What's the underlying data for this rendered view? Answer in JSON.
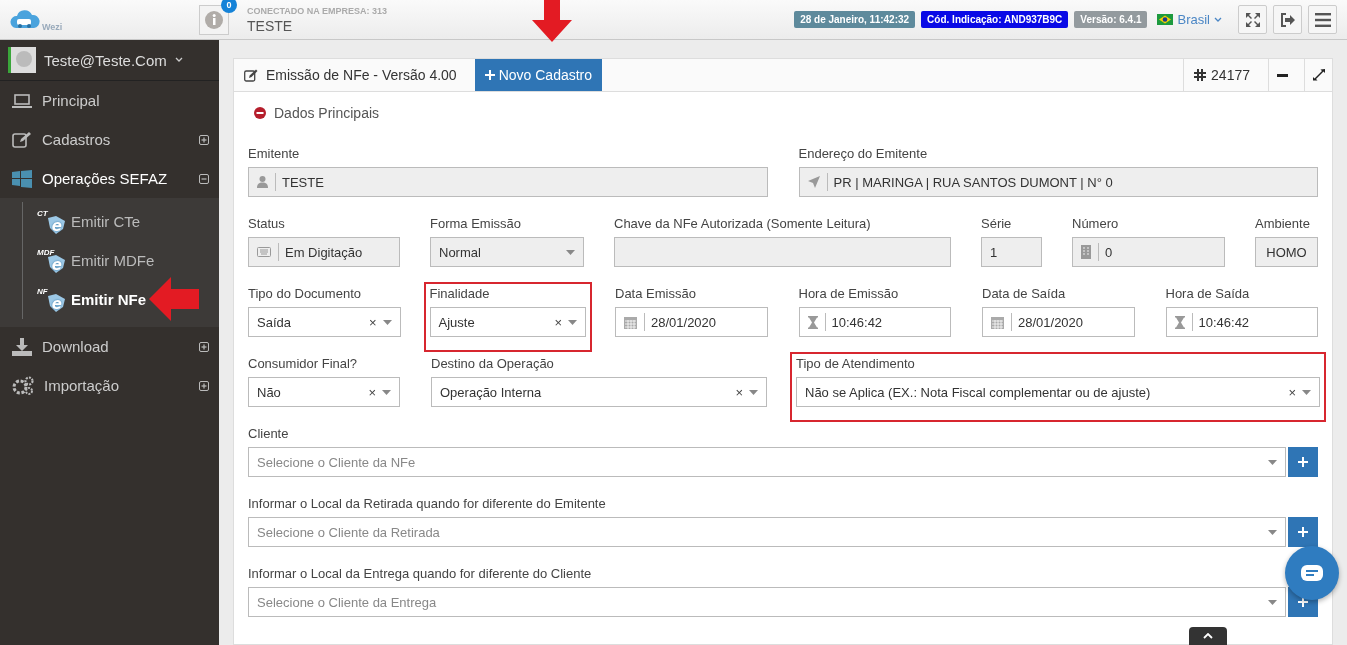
{
  "topbar": {
    "logo_text": "Wezi",
    "notifications": "0",
    "company_label": "CONECTADO NA EMPRESA: 313",
    "company_name": "TESTE",
    "badges": [
      {
        "text": "28 de Janeiro, 11:42:32",
        "color": "#5e8a9c"
      },
      {
        "text": "Cód. Indicação: AND937B9C",
        "color": "#0a0ae6"
      },
      {
        "text": "Versão: 6.4.1",
        "color": "#939a9e"
      }
    ],
    "language": "Brasil"
  },
  "sidebar": {
    "user": "Teste@Teste.Com",
    "items": [
      {
        "label": "Principal",
        "kind": "monitor",
        "expanded": false,
        "expandable": false
      },
      {
        "label": "Cadastros",
        "kind": "edit",
        "expanded": false,
        "expandable": true
      },
      {
        "label": "Operações SEFAZ",
        "kind": "windows",
        "expanded": true,
        "expandable": true,
        "children": [
          {
            "label": "Emitir CTe",
            "tag": "CT",
            "letter": "e",
            "selected": false
          },
          {
            "label": "Emitir MDFe",
            "tag": "MDF",
            "letter": "e",
            "selected": false
          },
          {
            "label": "Emitir NFe",
            "tag": "NF",
            "letter": "e",
            "selected": true
          }
        ]
      },
      {
        "label": "Download",
        "kind": "download",
        "expanded": false,
        "expandable": true
      },
      {
        "label": "Importação",
        "kind": "gears",
        "expanded": false,
        "expandable": true
      }
    ]
  },
  "panel": {
    "title": "Emissão de NFe - Versão 4.00",
    "new_button": "Novo Cadastro",
    "record_number": "24177",
    "section": "Dados Principais",
    "rows": [
      {
        "fields": [
          {
            "label": "Emitente",
            "value": "TESTE",
            "kind": "person",
            "readonly": true,
            "highlighted": false
          },
          {
            "label": "Endereço do Emitente",
            "value": "PR | MARINGA | RUA SANTOS DUMONT | N° 0",
            "kind": "pointer",
            "readonly": true,
            "highlighted": false
          }
        ]
      },
      {
        "fields": [
          {
            "label": "Status",
            "value": "Em Digitação",
            "kind": "keyboard",
            "readonly": true,
            "highlighted": false
          },
          {
            "label": "Forma Emissão",
            "value": "Normal",
            "kind": "dropdown",
            "readonly": true,
            "highlighted": false
          },
          {
            "label": "Chave da NFe Autorizada (Somente Leitura)",
            "kind": "plain",
            "readonly": true,
            "highlighted": false
          },
          {
            "label": "Série",
            "value": "1",
            "kind": "plain",
            "readonly": true,
            "highlighted": false
          },
          {
            "label": "Número",
            "value": "0",
            "kind": "building",
            "readonly": true,
            "highlighted": false
          },
          {
            "label": "Ambiente",
            "value": "HOMO",
            "kind": "centered",
            "readonly": true,
            "highlighted": false
          }
        ]
      },
      {
        "fields": [
          {
            "label": "Tipo do Documento",
            "value": "Saída",
            "kind": "dropdown",
            "readonly": false,
            "clear": "×",
            "highlighted": false
          },
          {
            "label": "Finalidade",
            "value": "Ajuste",
            "kind": "dropdown",
            "readonly": false,
            "clear": "×",
            "highlighted": true
          },
          {
            "label": "Data Emissão",
            "value": "28/01/2020",
            "kind": "calendar",
            "readonly": false,
            "highlighted": false
          },
          {
            "label": "Hora de Emissão",
            "value": "10:46:42",
            "kind": "hourglass",
            "readonly": false,
            "highlighted": false
          },
          {
            "label": "Data de Saída",
            "value": "28/01/2020",
            "kind": "calendar",
            "readonly": false,
            "highlighted": false
          },
          {
            "label": "Hora de Saída",
            "value": "10:46:42",
            "kind": "hourglass",
            "readonly": false,
            "highlighted": false
          }
        ]
      },
      {
        "fields": [
          {
            "label": "Consumidor Final?",
            "value": "Não",
            "kind": "dropdown",
            "readonly": false,
            "clear": "×",
            "highlighted": false
          },
          {
            "label": "Destino da Operação",
            "value": "Operação Interna",
            "kind": "dropdown",
            "readonly": false,
            "clear": "×",
            "highlighted": false
          },
          {
            "label": "Tipo de Atendimento",
            "value": "Não se Aplica (EX.: Nota Fiscal complementar ou de ajuste)",
            "kind": "dropdown",
            "readonly": false,
            "clear": "×",
            "highlighted": true
          }
        ]
      }
    ],
    "lookups": [
      {
        "label": "Cliente",
        "placeholder": "Selecione o Cliente da NFe"
      },
      {
        "label": "Informar o Local da Retirada quando for diferente do Emitente",
        "placeholder": "Selecione o Cliente da Retirada"
      },
      {
        "label": "Informar o Local da Entrega quando for diferente do Cliente",
        "placeholder": "Selecione o Cliente da Entrega"
      }
    ]
  }
}
